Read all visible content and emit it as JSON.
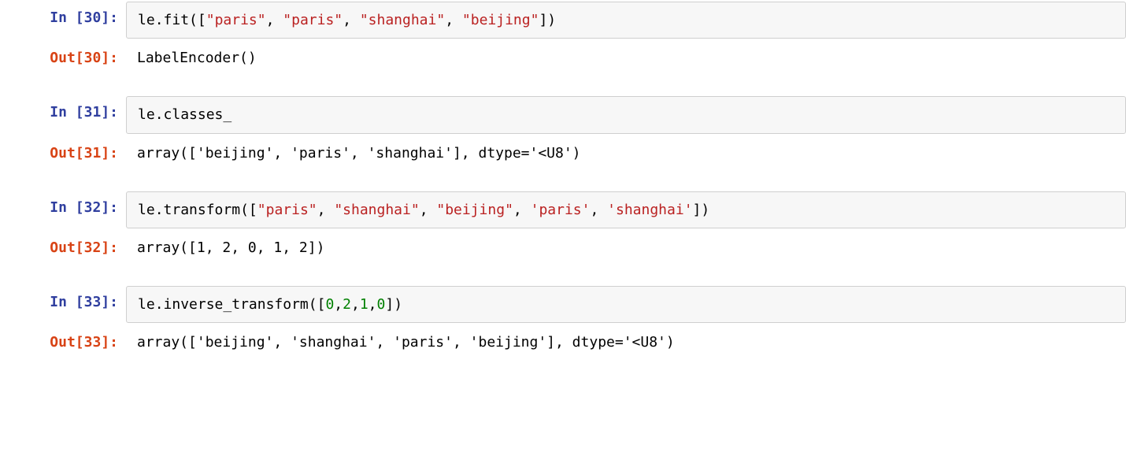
{
  "cells": [
    {
      "in_prompt": "In [30]:",
      "out_prompt": "Out[30]:",
      "code_tokens": [
        {
          "t": "le",
          "c": "tok-plain"
        },
        {
          "t": ".",
          "c": "tok-punc"
        },
        {
          "t": "fit",
          "c": "tok-func"
        },
        {
          "t": "([",
          "c": "tok-punc"
        },
        {
          "t": "\"paris\"",
          "c": "tok-str"
        },
        {
          "t": ", ",
          "c": "tok-punc"
        },
        {
          "t": "\"paris\"",
          "c": "tok-str"
        },
        {
          "t": ", ",
          "c": "tok-punc"
        },
        {
          "t": "\"shanghai\"",
          "c": "tok-str"
        },
        {
          "t": ", ",
          "c": "tok-punc"
        },
        {
          "t": "\"beijing\"",
          "c": "tok-str"
        },
        {
          "t": "])",
          "c": "tok-punc"
        }
      ],
      "output": "LabelEncoder()"
    },
    {
      "in_prompt": "In [31]:",
      "out_prompt": "Out[31]:",
      "code_tokens": [
        {
          "t": "le",
          "c": "tok-plain"
        },
        {
          "t": ".",
          "c": "tok-punc"
        },
        {
          "t": "classes_",
          "c": "tok-plain"
        }
      ],
      "output": "array(['beijing', 'paris', 'shanghai'], dtype='<U8')"
    },
    {
      "in_prompt": "In [32]:",
      "out_prompt": "Out[32]:",
      "code_tokens": [
        {
          "t": "le",
          "c": "tok-plain"
        },
        {
          "t": ".",
          "c": "tok-punc"
        },
        {
          "t": "transform",
          "c": "tok-func"
        },
        {
          "t": "([",
          "c": "tok-punc"
        },
        {
          "t": "\"paris\"",
          "c": "tok-str"
        },
        {
          "t": ", ",
          "c": "tok-punc"
        },
        {
          "t": "\"shanghai\"",
          "c": "tok-str"
        },
        {
          "t": ", ",
          "c": "tok-punc"
        },
        {
          "t": "\"beijing\"",
          "c": "tok-str"
        },
        {
          "t": ", ",
          "c": "tok-punc"
        },
        {
          "t": "'paris'",
          "c": "tok-str"
        },
        {
          "t": ", ",
          "c": "tok-punc"
        },
        {
          "t": "'shanghai'",
          "c": "tok-str"
        },
        {
          "t": "])",
          "c": "tok-punc"
        }
      ],
      "output": "array([1, 2, 0, 1, 2])"
    },
    {
      "in_prompt": "In [33]:",
      "out_prompt": "Out[33]:",
      "code_tokens": [
        {
          "t": "le",
          "c": "tok-plain"
        },
        {
          "t": ".",
          "c": "tok-punc"
        },
        {
          "t": "inverse_transform",
          "c": "tok-func"
        },
        {
          "t": "([",
          "c": "tok-punc"
        },
        {
          "t": "0",
          "c": "tok-num"
        },
        {
          "t": ",",
          "c": "tok-punc"
        },
        {
          "t": "2",
          "c": "tok-num"
        },
        {
          "t": ",",
          "c": "tok-punc"
        },
        {
          "t": "1",
          "c": "tok-num"
        },
        {
          "t": ",",
          "c": "tok-punc"
        },
        {
          "t": "0",
          "c": "tok-num"
        },
        {
          "t": "])",
          "c": "tok-punc"
        }
      ],
      "output": "array(['beijing', 'shanghai', 'paris', 'beijing'], dtype='<U8')"
    }
  ]
}
